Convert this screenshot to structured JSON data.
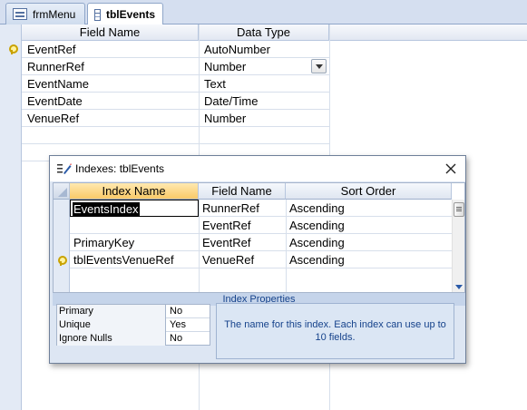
{
  "tabs": [
    {
      "label": "frmMenu",
      "icon": "form-icon",
      "active": false
    },
    {
      "label": "tblEvents",
      "icon": "table-icon",
      "active": true
    }
  ],
  "design_grid": {
    "headers": {
      "field_name": "Field Name",
      "data_type": "Data Type"
    },
    "rows": [
      {
        "field_name": "EventRef",
        "data_type": "AutoNumber",
        "primary_key": true
      },
      {
        "field_name": "RunnerRef",
        "data_type": "Number",
        "primary_key": false,
        "has_dropdown": true
      },
      {
        "field_name": "EventName",
        "data_type": "Text",
        "primary_key": false
      },
      {
        "field_name": "EventDate",
        "data_type": "Date/Time",
        "primary_key": false
      },
      {
        "field_name": "VenueRef",
        "data_type": "Number",
        "primary_key": false
      }
    ]
  },
  "indexes_dialog": {
    "title": "Indexes: tblEvents",
    "headers": {
      "index_name": "Index Name",
      "field_name": "Field Name",
      "sort_order": "Sort Order"
    },
    "rows": [
      {
        "index_name": "EventsIndex",
        "field_name": "RunnerRef",
        "sort_order": "Ascending",
        "primary_key": false,
        "editing": true
      },
      {
        "index_name": "",
        "field_name": "EventRef",
        "sort_order": "Ascending",
        "primary_key": false
      },
      {
        "index_name": "PrimaryKey",
        "field_name": "EventRef",
        "sort_order": "Ascending",
        "primary_key": true
      },
      {
        "index_name": "tblEventsVenueRef",
        "field_name": "VenueRef",
        "sort_order": "Ascending",
        "primary_key": false
      }
    ],
    "properties_label": "Index Properties",
    "properties": [
      {
        "name": "Primary",
        "value": "No"
      },
      {
        "name": "Unique",
        "value": "Yes"
      },
      {
        "name": "Ignore Nulls",
        "value": "No"
      }
    ],
    "help_text": "The name for this index.  Each index can use up to 10 fields."
  },
  "colors": {
    "accent_header": "#f9c968",
    "panel_blue": "#dde6f3",
    "help_text": "#15428b"
  }
}
